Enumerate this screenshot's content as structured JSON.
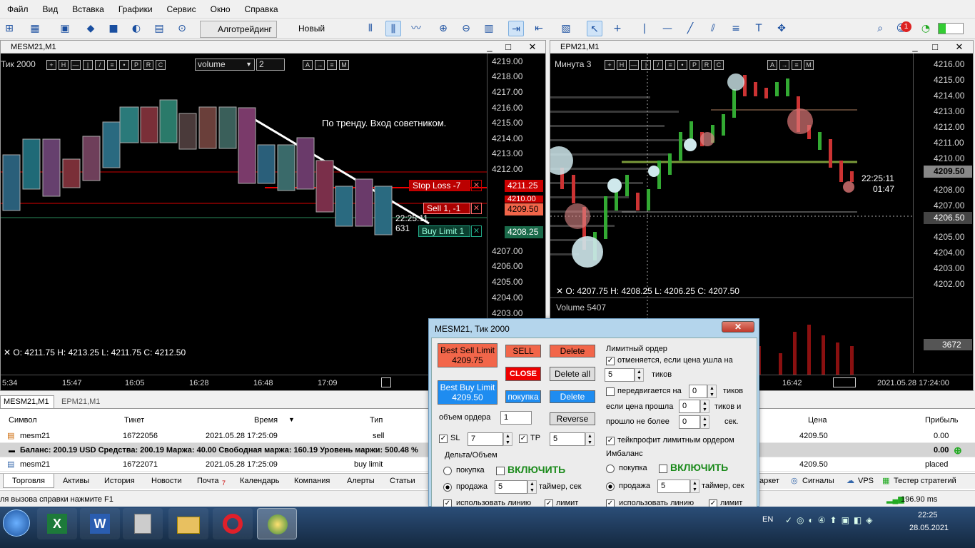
{
  "menu": [
    "Файл",
    "Вид",
    "Вставка",
    "Графики",
    "Сервис",
    "Окно",
    "Справка"
  ],
  "toolbar": {
    "algo_label": "Алготрейдинг",
    "neworder_label": "Новый ордер",
    "notif_count": "1"
  },
  "chart1": {
    "title": "MESM21,M1",
    "tf": "Тик  2000",
    "indicator": "volume",
    "period": "2",
    "prices": [
      "4219.00",
      "4218.00",
      "4217.00",
      "4216.00",
      "4215.00",
      "4214.00",
      "4213.00",
      "4212.00",
      "4211.00",
      "4210.00",
      "4209.00",
      "4208.00",
      "4207.00",
      "4206.00",
      "4205.00",
      "4204.00",
      "4203.00"
    ],
    "times": [
      "5:34",
      "15:47",
      "16:05",
      "16:28",
      "16:48",
      "17:09"
    ],
    "annotation": "По тренду. Вход советником.",
    "stop_loss_label": "Stop Loss  -7",
    "stop_loss_price": "4211.25",
    "sell_label": "Sell  1,  -1",
    "sell_price": "4209.50",
    "buy_limit_label": "Buy Limit  1",
    "buy_limit_price": "4208.25",
    "hidden_price": "4210.00",
    "timer": "22:25:11",
    "ticks": "631",
    "ohlc": "O: 4211.75   H: 4213.25   L: 4211.75   C: 4212.50"
  },
  "chart2": {
    "title": "EPM21,M1",
    "tf": "Минута  3",
    "prices": [
      "4216.00",
      "4215.00",
      "4214.00",
      "4213.00",
      "4212.00",
      "4211.00",
      "4210.00",
      "4209.00",
      "4208.00",
      "4207.00",
      "4206.00",
      "4205.00",
      "4204.00",
      "4203.00",
      "4202.00"
    ],
    "current_price": "4209.50",
    "cross_price": "4206.50",
    "timer": "22:25:11",
    "timer2": "01:47",
    "ohlc": "O: 4207.75   H: 4208.25   L: 4206.25   C: 4207.50",
    "volume_label": "Volume 5407",
    "volume_value": "3672",
    "times": [
      "16:42",
      "2021.05.28 17:24:00"
    ]
  },
  "tabs": {
    "chart1": "MESM21,M1",
    "chart2": "EPM21,M1"
  },
  "terminal": {
    "headers": {
      "symbol": "Символ",
      "ticket": "Тикет",
      "time": "Время",
      "type": "Тип",
      "price": "Цена",
      "profit": "Прибыль"
    },
    "rows": [
      {
        "symbol": "mesm21",
        "ticket": "16722056",
        "time": "2021.05.28 17:25:09",
        "type": "sell",
        "price": "4209.50",
        "profit": "0.00"
      },
      {
        "symbol": "mesm21",
        "ticket": "16722071",
        "time": "2021.05.28 17:25:09",
        "type": "buy limit",
        "price": "4209.50",
        "profit": "placed"
      }
    ],
    "balance": "Баланс: 200.19 USD  Средства: 200.19  Маржа: 40.00  Свободная маржа: 160.19  Уровень маржи: 500.48 %",
    "balance_profit": "0.00",
    "bottom_tabs": [
      "Торговля",
      "Активы",
      "История",
      "Новости",
      "Почта",
      "Календарь",
      "Компания",
      "Алерты",
      "Статьи"
    ],
    "mail_count": "7",
    "right_tabs": [
      "аркет",
      "Сигналы",
      "VPS",
      "Тестер стратегий"
    ],
    "status": "ля вызова справки нажмите F1",
    "ping": "196.90 ms"
  },
  "panel": {
    "title": "MESM21, Тик  2000",
    "close_icon": "x",
    "best_sell": "Best Sell Limit",
    "best_sell_price": "4209.75",
    "best_buy": "Best Buy Limit",
    "best_buy_price": "4209.50",
    "sell": "SELL",
    "close": "CLOSE",
    "buy": "покупка",
    "delete": "Delete",
    "delete_all": "Delete all",
    "reverse": "Reverse",
    "volume_label": "объем ордера",
    "volume": "1",
    "sl": "SL",
    "sl_value": "7",
    "tp": "TP",
    "tp_value": "5",
    "delta_title": "Дельта/Объем",
    "sell_rb": "продажа",
    "enable": "ВКЛЮЧИТЬ",
    "timer_label": "таймер, сек",
    "timer_value": "5",
    "use_line": "использовать линию",
    "limit": "лимит",
    "limit_title": "Лимитный ордер",
    "cancel_if": "отменяется, если цена ушла на",
    "cancel_val": "5",
    "ticks": "тиков",
    "moves_on": "передвигается на",
    "moves_val": "0",
    "ticks2": "тиков",
    "if_price": "если цена прошла",
    "if_val": "0",
    "ticks_and": "тиков и",
    "passed_no": "прошло не более",
    "passed_val": "0",
    "sec": "сек.",
    "tp_limit": "тейкпрофит лимитным ордером",
    "imb_title": "Имбаланс",
    "imb_buy": "покупка",
    "imb_sell": "продажа",
    "imb_enable": "ВКЛЮЧИТЬ",
    "imb_timer_label": "таймер, сек",
    "imb_timer": "5",
    "imb_line": "использовать линию",
    "imb_limit": "лимит"
  },
  "taskbar": {
    "lang": "EN",
    "time": "22:25",
    "date": "28.05.2021"
  }
}
